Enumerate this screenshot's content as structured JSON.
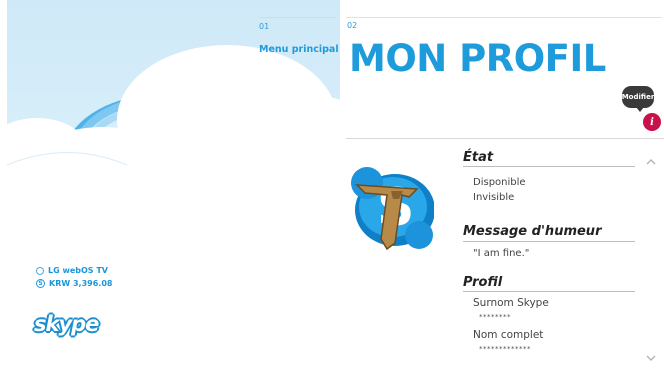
{
  "left": {
    "step": "01",
    "menu_label": "Menu principal",
    "device_label": "LG webOS TV",
    "balance_label": "KRW 3,396.08",
    "balance_icon_glyph": "S",
    "logo_text": "skype"
  },
  "right": {
    "step": "02",
    "title": "MON PROFIL",
    "edit_label": "Modifier",
    "info_glyph": "i",
    "status": {
      "title": "État",
      "options": [
        "Disponible",
        "Invisible"
      ]
    },
    "mood": {
      "title": "Message d'humeur",
      "text": "\"I am fine.\""
    },
    "profile": {
      "title": "Profil",
      "fields": [
        {
          "label": "Surnom Skype",
          "value": "********"
        },
        {
          "label": "Nom complet",
          "value": "*************"
        }
      ]
    }
  },
  "colors": {
    "accent": "#1e9bdb",
    "info_button": "#c8114a",
    "edit_button": "#3a3a3a"
  },
  "icons": [
    "cloud-background",
    "status-circle-icon",
    "currency-icon",
    "skype-logo",
    "info-icon",
    "chevron-up-icon",
    "chevron-down-icon",
    "skype-tie-avatar"
  ]
}
